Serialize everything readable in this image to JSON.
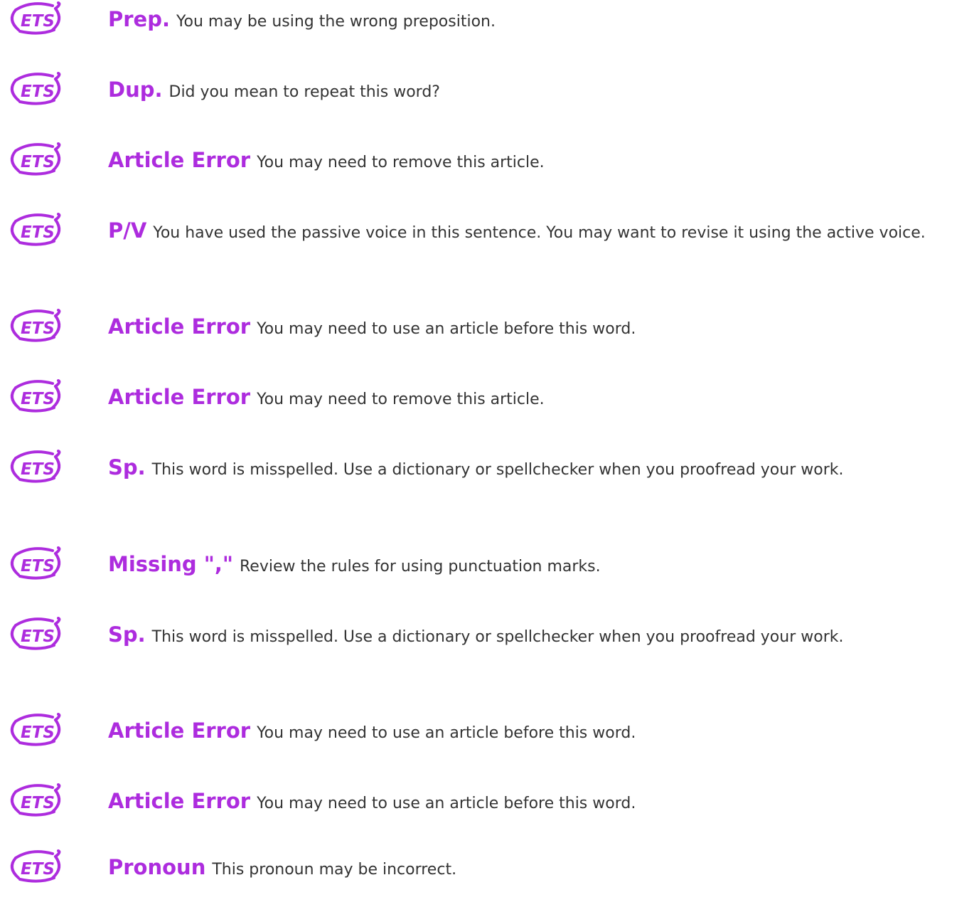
{
  "brand": {
    "logo_text": "ETS",
    "logo_icon": "ets-logo-icon",
    "accent_color": "#ad2cde",
    "text_color": "#333333"
  },
  "feedback": [
    {
      "tag": "Prep.",
      "message": "You may be using the wrong preposition."
    },
    {
      "tag": "Dup.",
      "message": "Did you mean to repeat this word?"
    },
    {
      "tag": "Article Error",
      "message": "You may need to remove this article."
    },
    {
      "tag": "P/V",
      "message": "You have used the passive voice in this sentence. You may want to revise it using the active voice."
    },
    {
      "tag": "Article Error",
      "message": "You may need to use an article before this word."
    },
    {
      "tag": "Article Error",
      "message": "You may need to remove this article."
    },
    {
      "tag": "Sp.",
      "message": "This word is misspelled. Use a dictionary or spellchecker when you proofread your work."
    },
    {
      "tag": "Missing \",\"",
      "message": "Review the rules for using punctuation marks."
    },
    {
      "tag": "Sp.",
      "message": "This word is misspelled. Use a dictionary or spellchecker when you proofread your work."
    },
    {
      "tag": "Article Error",
      "message": "You may need to use an article before this word."
    },
    {
      "tag": "Article Error",
      "message": "You may need to use an article before this word."
    },
    {
      "tag": "Pronoun",
      "message": "This pronoun may be incorrect."
    }
  ]
}
